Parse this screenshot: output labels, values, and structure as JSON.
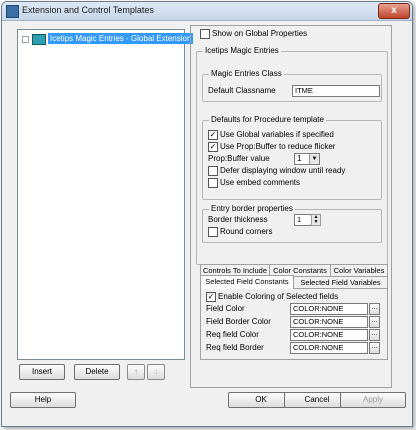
{
  "window": {
    "title": "Extension and Control Templates",
    "close_glyph": "x"
  },
  "tree": {
    "item_label": "Icetips Magic Entries - Global Extension"
  },
  "left_buttons": {
    "insert": "Insert",
    "delete": "Delete",
    "up": "↑",
    "down": "↓"
  },
  "show_global": {
    "label": "Show on Global Properties",
    "checked": false
  },
  "group_main": {
    "title": "Icetips Magic Entries"
  },
  "class_group": {
    "title": "Magic Entries Class",
    "default_label": "Default Classname",
    "default_value": "ITME"
  },
  "defaults_group": {
    "title": "Defaults for Procedure template",
    "use_global": "Use Global variables if specified",
    "use_global_checked": true,
    "use_prop": "Use Prop:Buffer to reduce flicker",
    "use_prop_checked": true,
    "prop_label": "Prop:Buffer value",
    "prop_value": "1",
    "defer": "Defer displaying window until ready",
    "defer_checked": false,
    "embed": "Use embed comments",
    "embed_checked": false
  },
  "border_group": {
    "title": "Entry border properties",
    "thickness_label": "Border thickness",
    "thickness_value": "1",
    "round_corners": "Round corners",
    "round_checked": false
  },
  "tabs": {
    "row1": [
      "Controls To Include",
      "Color Constants",
      "Color Variables"
    ],
    "row2": [
      "Selected Field Constants",
      "Selected Field Variables"
    ]
  },
  "field_colors": {
    "enable_label": "Enable Coloring of Selected fields",
    "enable_checked": true,
    "rows": [
      {
        "label": "Field Color",
        "value": "COLOR:NONE"
      },
      {
        "label": "Field Border Color",
        "value": "COLOR:NONE"
      },
      {
        "label": "Req field Color",
        "value": "COLOR:NONE"
      },
      {
        "label": "Req field Border",
        "value": "COLOR:NONE"
      }
    ],
    "dots": "..."
  },
  "footer": {
    "help": "Help",
    "ok": "OK",
    "cancel": "Cancel",
    "apply": "Apply"
  },
  "colors": {
    "selection": "#3399ff",
    "title_gradient_top": "#dfe9f5",
    "close_red": "#c0452c"
  }
}
